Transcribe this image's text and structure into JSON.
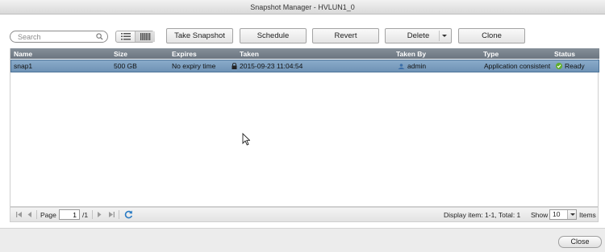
{
  "window": {
    "title": "Snapshot Manager - HVLUN1_0"
  },
  "toolbar": {
    "search_placeholder": "Search",
    "buttons": {
      "take_snapshot": "Take Snapshot",
      "schedule": "Schedule",
      "revert": "Revert",
      "delete": "Delete",
      "clone": "Clone"
    }
  },
  "table": {
    "columns": [
      "Name",
      "Size",
      "Expires",
      "Taken",
      "Taken By",
      "Type",
      "Status"
    ],
    "rows": [
      {
        "name": "snap1",
        "size": "500 GB",
        "expires": "No expiry time",
        "taken": "2015-09-23 11:04:54",
        "taken_by": "admin",
        "type": "Application consistent",
        "status": "Ready"
      }
    ]
  },
  "pager": {
    "page_label": "Page",
    "page_value": "1",
    "total_pages": "/1",
    "display_info": "Display item: 1-1, Total: 1",
    "show_label": "Show",
    "show_value": "10",
    "items_label": "Items"
  },
  "footer": {
    "close_label": "Close"
  },
  "colors": {
    "header_bg": "#6b7580",
    "selected_row": "#7d9fc0",
    "ready": "#5fae2c"
  }
}
